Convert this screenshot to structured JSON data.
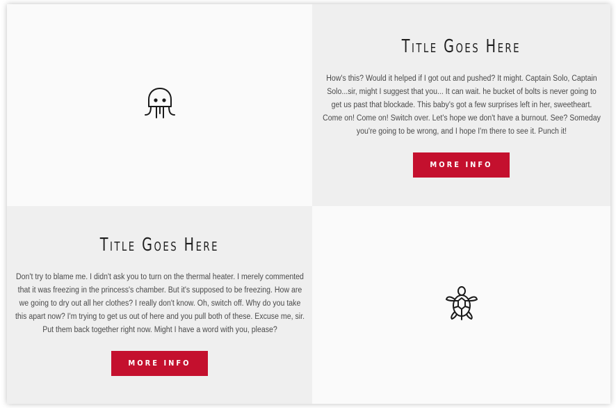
{
  "cards": [
    {
      "title": "Title Goes Here",
      "body": "How's this? Would it helped if I got out and pushed? It might. Captain Solo, Captain Solo...sir, might I suggest that you... It can wait. he bucket of bolts is never going to get us past that blockade. This baby's got a few surprises left in her, sweetheart. Come on! Come on! Switch over. Let's hope we don't have a burnout. See? Someday you're going to be wrong, and I hope I'm there to see it. Punch it!",
      "button_label": "MORE INFO"
    },
    {
      "title": "Title Goes Here",
      "body": "Don't try to blame me. I didn't ask you to turn on the thermal heater. I merely commented that it was freezing in the princess's chamber. But it's supposed to be freezing. How are we going to dry out all her clothes? I really don't know. Oh, switch off. Why do you take this apart now? I'm trying to get us out of here and you pull both of these. Excuse me, sir. Put them back together right now. Might I have a word with you, please?",
      "button_label": "MORE INFO"
    }
  ],
  "icons": {
    "top_left": "jellyfish-icon",
    "bottom_right": "turtle-icon"
  },
  "colors": {
    "accent": "#c4102e",
    "panel_grey": "#efefef",
    "panel_light": "#fafafa"
  }
}
